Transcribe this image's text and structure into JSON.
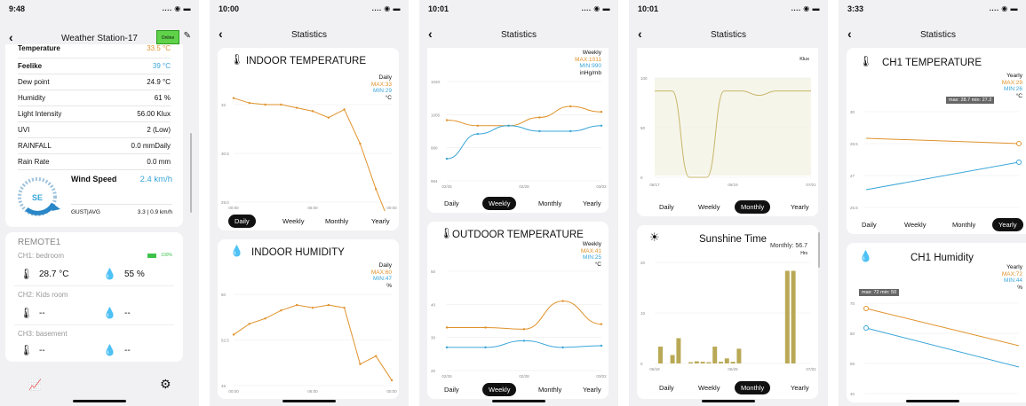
{
  "phone1": {
    "time": "9:48",
    "title": "Weather Station-17",
    "badge": "Online",
    "rows": [
      {
        "label": "Temperature",
        "value": "33.5 °C"
      },
      {
        "label": "Feelike",
        "value": "39 °C"
      },
      {
        "label": "Dew point",
        "value": "24.9 °C"
      },
      {
        "label": "Humidity",
        "value": "61 %"
      },
      {
        "label": "Light Intensity",
        "value": "56.00 Klux"
      },
      {
        "label": "UVI",
        "value": "2 (Low)"
      },
      {
        "label": "RAINFALL",
        "value": "0.0 mmDaily"
      },
      {
        "label": "Rain Rate",
        "value": "0.0 mm"
      }
    ],
    "wind": {
      "label": "Wind Speed",
      "value": "2.4 km/h",
      "dir": "SE",
      "gust_label": "GUST|AVG",
      "gust_value": "3.3 | 0.9 km/h"
    },
    "remote": {
      "title": "REMOTE1",
      "ch1": {
        "name": "CH1: bedroom",
        "temp": "28.7 °C",
        "hum": "55 %",
        "batt": "100%"
      },
      "ch2": {
        "name": "CH2: Kids room",
        "temp": "--",
        "hum": "--"
      },
      "ch3": {
        "name": "CH3: basement",
        "temp": "--",
        "hum": "--"
      }
    }
  },
  "phone2": {
    "time": "10:00",
    "title": "Statistics",
    "card1": {
      "title": "INDOOR TEMPERATURE",
      "period": "Daily",
      "max": "MAX:33",
      "min": "MIN:29",
      "unit": "°C",
      "yticks": [
        "32",
        "30.5",
        "29.0"
      ],
      "xticks": [
        "00:00",
        "06:00",
        "00:00"
      ],
      "tabs": [
        "Daily",
        "Weekly",
        "Monthly",
        "Yearly"
      ],
      "selected": "Daily"
    },
    "card2": {
      "title": "INDOOR HUMIDITY",
      "period": "Daily",
      "max": "MAX:60",
      "min": "MIN:47",
      "unit": "%",
      "yticks": [
        "60",
        "52.5",
        "45"
      ],
      "xticks": [
        "00:00",
        "06:00",
        "00:00"
      ]
    }
  },
  "phone3": {
    "time": "10:01",
    "title": "Statistics",
    "card1": {
      "period": "Weekly",
      "max": "MAX:1011",
      "min": "MIN:990",
      "unit": "inHg/mb",
      "yticks": [
        "1020",
        "1005",
        "990",
        "984"
      ],
      "xticks": [
        "02/25",
        "02/28",
        "03/02"
      ],
      "tabs": [
        "Daily",
        "Weekly",
        "Monthly",
        "Yearly"
      ],
      "selected": "Weekly"
    },
    "card2": {
      "title": "OUTDOOR TEMPERATURE",
      "period": "Weekly",
      "max": "MAX:41",
      "min": "MIN:25",
      "unit": "°C",
      "yticks": [
        "50",
        "40",
        "30",
        "20"
      ],
      "xticks": [
        "02/26",
        "02/28",
        "03/02"
      ],
      "tabs": [
        "Daily",
        "Weekly",
        "Monthly",
        "Yearly"
      ],
      "selected": "Weekly"
    }
  },
  "phone4": {
    "time": "10:01",
    "title": "Statistics",
    "card1": {
      "unit": "Klux",
      "yticks": [
        "100",
        "50",
        "0"
      ],
      "xticks": [
        "06/17",
        "06/19",
        "07/01"
      ],
      "tabs": [
        "Daily",
        "Weekly",
        "Monthly",
        "Yearly"
      ],
      "selected": "Monthly"
    },
    "card2": {
      "title": "Sunshine Time",
      "monthly": "Monthly: 56.7",
      "unit": "Hrs",
      "yticks": [
        "20",
        "10",
        "0"
      ],
      "xticks": [
        "06/18",
        "06/25",
        "07/02"
      ],
      "tabs": [
        "Daily",
        "Weekly",
        "Monthly",
        "Yearly"
      ],
      "selected": "Monthly"
    }
  },
  "phone5": {
    "time": "3:33",
    "title": "Statistics",
    "card1": {
      "title": "CH1 TEMPERATURE",
      "period": "Yearly",
      "max": "MAX:29",
      "min": "MIN:26",
      "unit": "°C",
      "tooltip": "max: 28.7  min: 27.2",
      "yticks": [
        "30",
        "28.5",
        "27",
        "25.5"
      ],
      "tabs": [
        "Daily",
        "Weekly",
        "Monthly",
        "Yearly"
      ],
      "selected": "Yearly"
    },
    "card2": {
      "title": "CH1 Humidity",
      "period": "Yearly",
      "max": "MAX:72",
      "min": "MIN:44",
      "unit": "%",
      "tooltip": "max: 72  min: 50",
      "yticks": [
        "70",
        "60",
        "50",
        "40"
      ]
    }
  }
}
